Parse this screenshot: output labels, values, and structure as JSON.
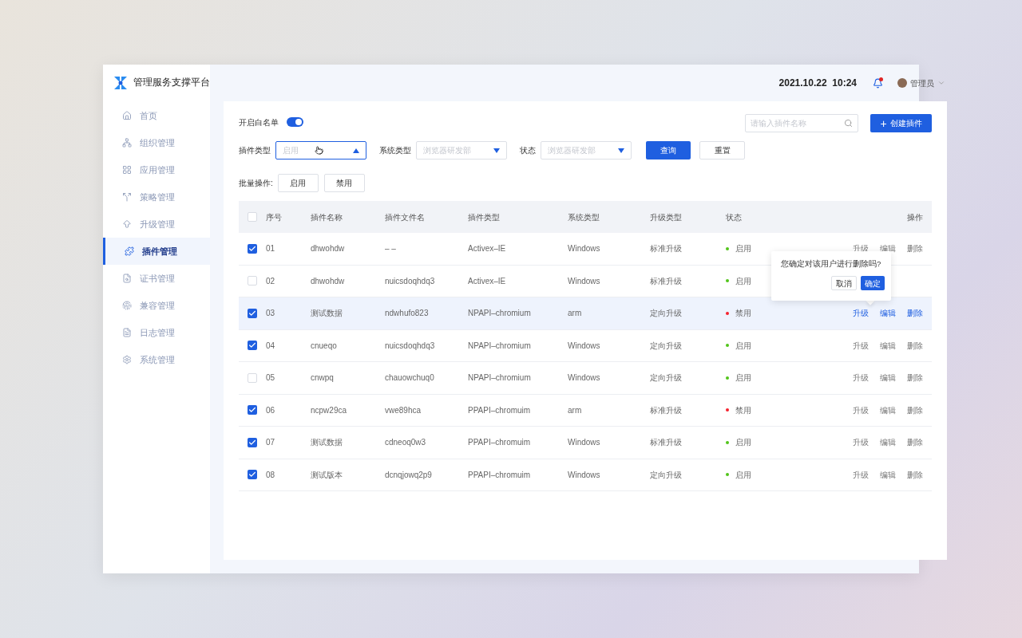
{
  "brand": {
    "title": "管理服务支撑平台"
  },
  "sidebar": {
    "items": [
      {
        "label": "首页",
        "selected": false
      },
      {
        "label": "组织管理",
        "selected": false
      },
      {
        "label": "应用管理",
        "selected": false
      },
      {
        "label": "策略管理",
        "selected": false
      },
      {
        "label": "升级管理",
        "selected": false
      },
      {
        "label": "插件管理",
        "selected": true
      },
      {
        "label": "证书管理",
        "selected": false
      },
      {
        "label": "兼容管理",
        "selected": false
      },
      {
        "label": "日志管理",
        "selected": false
      },
      {
        "label": "系统管理",
        "selected": false
      }
    ]
  },
  "header": {
    "datetime": "2021.10.22  10:24",
    "has_notification": true,
    "user": "管理员"
  },
  "whitelist": {
    "label": "开启白名单",
    "on": true
  },
  "search": {
    "placeholder": "请输入插件名称"
  },
  "create_button": {
    "icon": "+",
    "label": "创建插件"
  },
  "filters": [
    {
      "label": "插件类型",
      "placeholder": "启用",
      "open": true
    },
    {
      "label": "系统类型",
      "placeholder": "浏览器研发部",
      "open": false
    },
    {
      "label": "状态",
      "placeholder": "浏览器研发部",
      "open": false
    }
  ],
  "query_button": "查询",
  "reset_button": "重置",
  "batch": {
    "label": "批量操作:",
    "buttons": [
      "启用",
      "禁用"
    ]
  },
  "table": {
    "all_checked": false,
    "columns": [
      "序号",
      "插件名称",
      "插件文件名",
      "插件类型",
      "系统类型",
      "升级类型",
      "状态",
      "操作"
    ],
    "rows": [
      {
        "checked": true,
        "highlighted": false,
        "no": "01",
        "name": "dhwohdw",
        "file": "– –",
        "type": "Activex–IE",
        "system": "Windows",
        "upgrade": "标准升级",
        "enabled": true,
        "status": "启用",
        "actions": [
          "升级",
          "编辑",
          "删除"
        ]
      },
      {
        "checked": false,
        "highlighted": false,
        "no": "02",
        "name": "dhwohdw",
        "file": "nuicsdoqhdq3",
        "type": "Activex–IE",
        "system": "Windows",
        "upgrade": "标准升级",
        "enabled": true,
        "status": "启用"
      },
      {
        "checked": true,
        "highlighted": true,
        "no": "03",
        "name": "测试数据",
        "file": "ndwhufo823",
        "type": "NPAPI–chromium",
        "system": "arm",
        "upgrade": "定向升级",
        "enabled": false,
        "status": "禁用",
        "actions": [
          "升级",
          "编辑",
          "删除"
        ]
      },
      {
        "checked": true,
        "highlighted": false,
        "no": "04",
        "name": "cnueqo",
        "file": "nuicsdoqhdq3",
        "type": "NPAPI–chromium",
        "system": "Windows",
        "upgrade": "定向升级",
        "enabled": true,
        "status": "启用",
        "actions": [
          "升级",
          "编辑",
          "删除"
        ]
      },
      {
        "checked": false,
        "highlighted": false,
        "no": "05",
        "name": "cnwpq",
        "file": "chauowchuq0",
        "type": "NPAPI–chromium",
        "system": "Windows",
        "upgrade": "定向升级",
        "enabled": true,
        "status": "启用",
        "actions": [
          "升级",
          "编辑",
          "删除"
        ]
      },
      {
        "checked": true,
        "highlighted": false,
        "no": "06",
        "name": "ncpw29ca",
        "file": "vwe89hca",
        "type": "PPAPI–chromuim",
        "system": "arm",
        "upgrade": "标准升级",
        "enabled": false,
        "status": "禁用",
        "actions": [
          "升级",
          "编辑",
          "删除"
        ]
      },
      {
        "checked": true,
        "highlighted": false,
        "no": "07",
        "name": "测试数据",
        "file": "cdneoq0w3",
        "type": "PPAPI–chromuim",
        "system": "Windows",
        "upgrade": "标准升级",
        "enabled": true,
        "status": "启用",
        "actions": [
          "升级",
          "编辑",
          "删除"
        ]
      },
      {
        "checked": true,
        "highlighted": false,
        "no": "08",
        "name": "测试版本",
        "file": "dcnqjowq2p9",
        "type": "PPAPI–chromuim",
        "system": "Windows",
        "upgrade": "定向升级",
        "enabled": true,
        "status": "启用",
        "actions": [
          "升级",
          "编辑",
          "删除"
        ]
      }
    ]
  },
  "popconfirm": {
    "message": "您确定对该用户进行删除吗?",
    "cancel": "取消",
    "confirm": "确定"
  }
}
